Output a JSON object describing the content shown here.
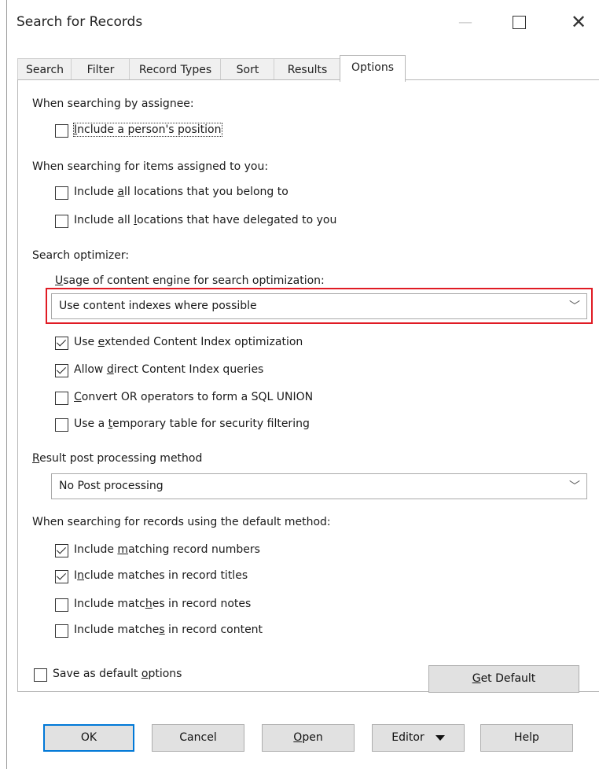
{
  "window": {
    "title": "Search for Records"
  },
  "tabs": [
    {
      "label": "Search"
    },
    {
      "label": "Filter"
    },
    {
      "label": "Record Types"
    },
    {
      "label": "Sort"
    },
    {
      "label": "Results"
    },
    {
      "label": "Options",
      "active": true
    }
  ],
  "assignee": {
    "heading": "When searching by assignee:",
    "position": {
      "label": "Include a person's position",
      "checked": false
    }
  },
  "assigned": {
    "heading": "When searching for items assigned to you:",
    "all_locations": {
      "label_pre": "Include ",
      "label_u": "a",
      "label_post": "ll locations that you belong to",
      "checked": false
    },
    "delegated": {
      "label_pre": "Include all ",
      "label_u": "l",
      "label_post": "ocations that have delegated to you",
      "checked": false
    }
  },
  "optimizer": {
    "heading": "Search optimizer:",
    "usage_label_u": "U",
    "usage_label_rest": "sage of content engine for search optimization:",
    "usage_value": "Use content indexes where possible",
    "extended": {
      "label_pre": "Use ",
      "label_u": "e",
      "label_post": "xtended Content Index optimization",
      "checked": true
    },
    "direct": {
      "label_pre": "Allow ",
      "label_u": "d",
      "label_post": "irect Content Index queries",
      "checked": true
    },
    "union": {
      "label_pre": "",
      "label_u": "C",
      "label_post": "onvert OR operators to form a SQL UNION",
      "checked": false
    },
    "temp_table": {
      "label_pre": "Use a ",
      "label_u": "t",
      "label_post": "emporary table for security filtering",
      "checked": false
    }
  },
  "post": {
    "label_u": "R",
    "label_rest": "esult post processing method",
    "value": "No Post processing"
  },
  "default_method": {
    "heading": "When searching for records using the default method:",
    "numbers": {
      "label_pre": "Include ",
      "label_u": "m",
      "label_post": "atching record numbers",
      "checked": true
    },
    "titles": {
      "label_pre": "I",
      "label_u": "n",
      "label_post": "clude matches in record titles",
      "checked": true
    },
    "notes": {
      "label_pre": "Include matc",
      "label_u": "h",
      "label_post": "es in record notes",
      "checked": false
    },
    "content": {
      "label_pre": "Include matche",
      "label_u": "s",
      "label_post": " in record content",
      "checked": false
    }
  },
  "save_default": {
    "label_pre": "Save as default ",
    "label_u": "o",
    "label_post": "ptions",
    "checked": false
  },
  "get_default": {
    "label_u": "G",
    "label_rest": "et Default"
  },
  "buttons": {
    "ok": "OK",
    "cancel": "Cancel",
    "open_u": "O",
    "open_rest": "pen",
    "editor": "Editor",
    "help": "Help"
  },
  "colors": {
    "highlight": "#e01b24",
    "default_button_border": "#0078d7"
  }
}
